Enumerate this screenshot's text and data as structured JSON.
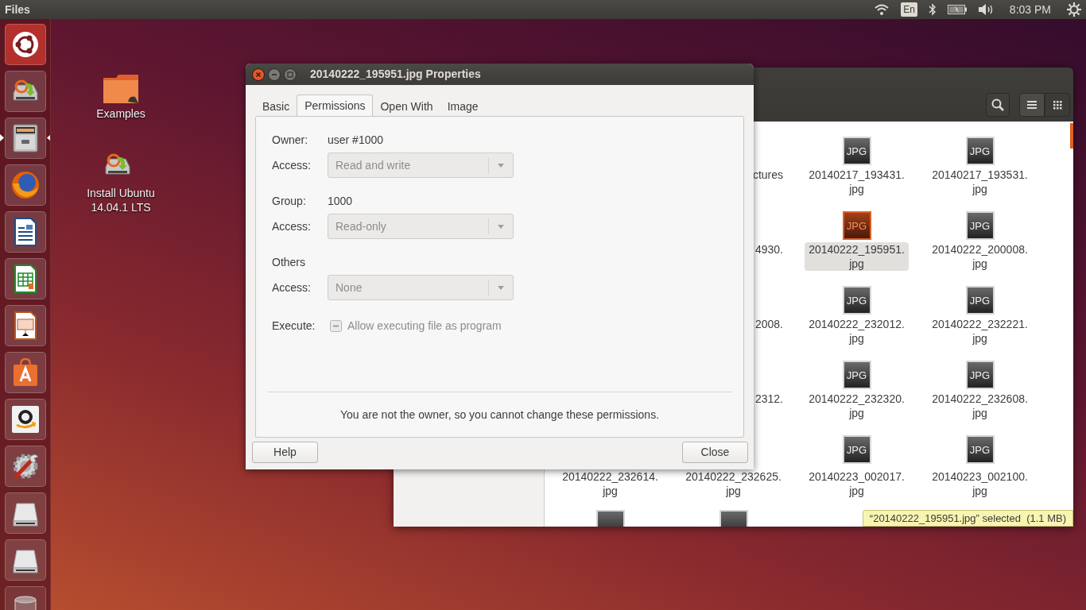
{
  "top_panel": {
    "app_name": "Files",
    "keyboard_layout": "En",
    "clock": "8:03 PM"
  },
  "launcher": [
    {
      "kind": "ubuntu",
      "active": false
    },
    {
      "kind": "installer",
      "active": false
    },
    {
      "kind": "files",
      "active": true
    },
    {
      "kind": "firefox",
      "active": false
    },
    {
      "kind": "writer",
      "active": false
    },
    {
      "kind": "calc",
      "active": false
    },
    {
      "kind": "impress",
      "active": false
    },
    {
      "kind": "software",
      "active": false
    },
    {
      "kind": "amazon",
      "active": false
    },
    {
      "kind": "settings",
      "active": false
    },
    {
      "kind": "drive",
      "active": false
    },
    {
      "kind": "drive",
      "active": false
    },
    {
      "kind": "trash",
      "active": false
    }
  ],
  "desktop_icons": [
    {
      "kind": "folder",
      "label": "Examples"
    },
    {
      "kind": "installer",
      "label": "Install Ubuntu 14.04.1 LTS"
    }
  ],
  "file_manager": {
    "rows": [
      {
        "peek": "ctures",
        "items": [
          {
            "icon_text": "JPG",
            "label": [
              "20140217_193431.",
              "jpg"
            ],
            "selected": false
          },
          {
            "icon_text": "JPG",
            "label": [
              "20140217_193531.",
              "jpg"
            ],
            "selected": false
          }
        ]
      },
      {
        "peek": "4930.",
        "items": [
          {
            "icon_text": "JPG",
            "label": [
              "20140222_195951.",
              "jpg"
            ],
            "selected": true
          },
          {
            "icon_text": "JPG",
            "label": [
              "20140222_200008.",
              "jpg"
            ],
            "selected": false
          }
        ]
      },
      {
        "peek": "2008.",
        "items": [
          {
            "icon_text": "JPG",
            "label": [
              "20140222_232012.",
              "jpg"
            ],
            "selected": false
          },
          {
            "icon_text": "JPG",
            "label": [
              "20140222_232221.",
              "jpg"
            ],
            "selected": false
          }
        ]
      },
      {
        "peek": "2312.",
        "items": [
          {
            "icon_text": "JPG",
            "label": [
              "20140222_232320.",
              "jpg"
            ],
            "selected": false
          },
          {
            "icon_text": "JPG",
            "label": [
              "20140222_232608.",
              "jpg"
            ],
            "selected": false
          }
        ]
      },
      {
        "items": [
          {
            "label": [
              "20140222_232614.",
              "jpg"
            ],
            "selected": false
          },
          {
            "label": [
              "20140222_232625.",
              "jpg"
            ],
            "selected": false
          },
          {
            "icon_text": "JPG",
            "label": [
              "20140223_002017.",
              "jpg"
            ],
            "selected": false
          },
          {
            "icon_text": "JPG",
            "label": [
              "20140223_002100.",
              "jpg"
            ],
            "selected": false
          }
        ]
      },
      {
        "items": [
          {
            "selected": false
          },
          {
            "selected": false
          }
        ]
      }
    ],
    "status": "“20140222_195951.jpg” selected  (1.1 MB)"
  },
  "dialog": {
    "title": "20140222_195951.jpg Properties",
    "tabs": [
      {
        "label": "Basic",
        "selected": false
      },
      {
        "label": "Permissions",
        "selected": true
      },
      {
        "label": "Open With",
        "selected": false
      },
      {
        "label": "Image",
        "selected": false
      }
    ],
    "groups": [
      {
        "label": "Owner:",
        "value": "user #1000",
        "access_label": "Access:",
        "access": "Read and write",
        "disabled": true
      },
      {
        "label": "Group:",
        "value": "1000",
        "access_label": "Access:",
        "access": "Read-only",
        "disabled": true
      },
      {
        "label": "Others",
        "access_label": "Access:",
        "access": "None",
        "disabled": true
      }
    ],
    "execute": {
      "label": "Execute:",
      "checkbox_label": "Allow executing file as program",
      "checked": false,
      "mixed": true,
      "disabled": true
    },
    "note": "You are not the owner, so you cannot change these permissions.",
    "buttons": [
      "Help",
      "Close"
    ]
  }
}
